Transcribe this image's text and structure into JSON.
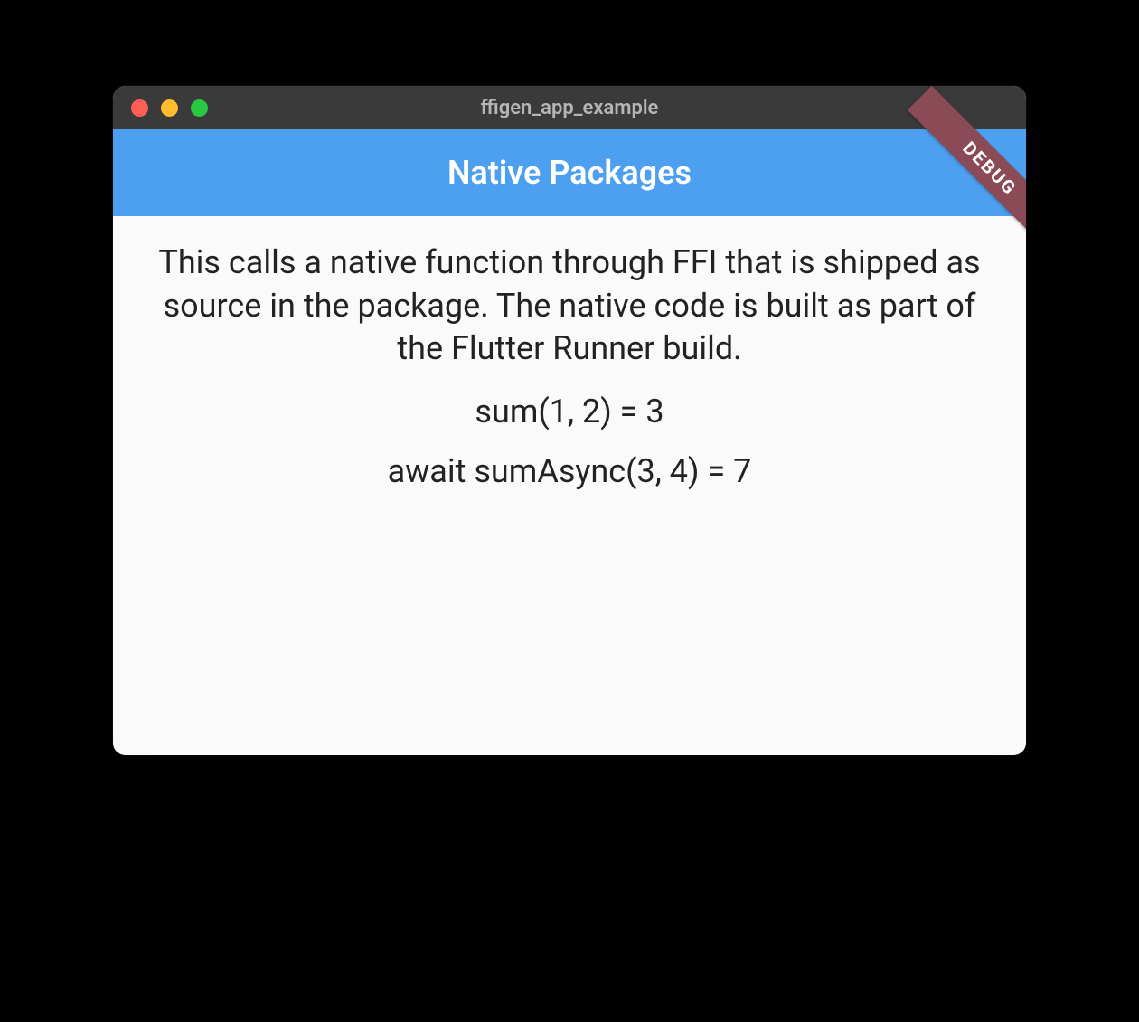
{
  "window": {
    "title": "ffigen_app_example"
  },
  "appbar": {
    "title": "Native Packages"
  },
  "content": {
    "description": "This calls a native function through FFI that is shipped as source in the package. The native code is built as part of the Flutter Runner build.",
    "sum_result": "sum(1, 2) = 3",
    "sum_async_result": "await sumAsync(3, 4) = 7"
  },
  "banner": {
    "label": "DEBUG"
  }
}
